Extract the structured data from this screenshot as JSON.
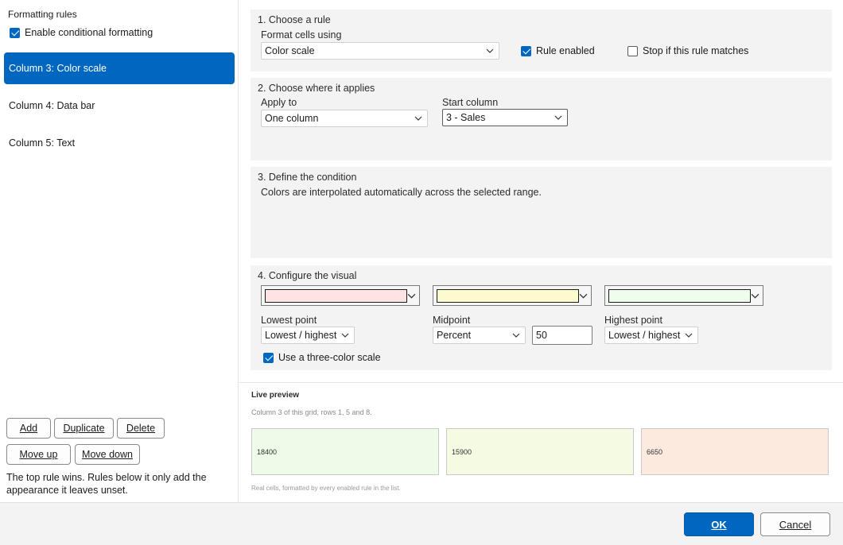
{
  "sidebar": {
    "header": "Formatting rules",
    "enable_label": "Enable conditional formatting",
    "enable_checked": true,
    "rules": [
      {
        "label": "Column 3: Color scale",
        "selected": true
      },
      {
        "label": "Column 4: Data bar",
        "selected": false
      },
      {
        "label": "Column 5: Text",
        "selected": false
      }
    ],
    "buttons": {
      "add": "Add",
      "duplicate": "Duplicate",
      "delete": "Delete",
      "move_up": "Move up",
      "move_down": "Move down"
    },
    "help_text": "The top rule wins. Rules below it only add the appearance it leaves unset."
  },
  "section1": {
    "title": "1. Choose a rule",
    "format_label": "Format cells using",
    "format_value": "Color scale",
    "rule_enabled_label": "Rule enabled",
    "rule_enabled_checked": true,
    "stop_label": "Stop if this rule matches",
    "stop_checked": false
  },
  "section2": {
    "title": "2. Choose where it applies",
    "apply_label": "Apply to",
    "apply_value": "One column",
    "start_label": "Start column",
    "start_value": "3 - Sales"
  },
  "section3": {
    "title": "3. Define the condition",
    "description": "Colors are interpolated automatically across the selected range."
  },
  "section4": {
    "title": "4. Configure the visual",
    "colors": [
      "#fde3e2",
      "#fbfbce",
      "#effdec"
    ],
    "lowest_label": "Lowest point",
    "lowest_value": "Lowest / highest",
    "mid_label": "Midpoint",
    "mid_value": "Percent",
    "mid_number": "50",
    "highest_label": "Highest point",
    "highest_value": "Lowest / highest",
    "three_color_label": "Use a three-color scale",
    "three_color_checked": true
  },
  "preview": {
    "title": "Live preview",
    "subtitle": "Column 3 of this grid, rows 1, 5 and 8.",
    "cells": [
      {
        "value": "18400",
        "color": "#eefbe8"
      },
      {
        "value": "15900",
        "color": "#f5fbe2"
      },
      {
        "value": "6650",
        "color": "#fdeadf"
      }
    ],
    "footnote": "Real cells, formatted by every enabled rule in the list."
  },
  "footer": {
    "ok": "OK",
    "cancel": "Cancel"
  },
  "colors": {
    "accent": "#0067c0"
  }
}
